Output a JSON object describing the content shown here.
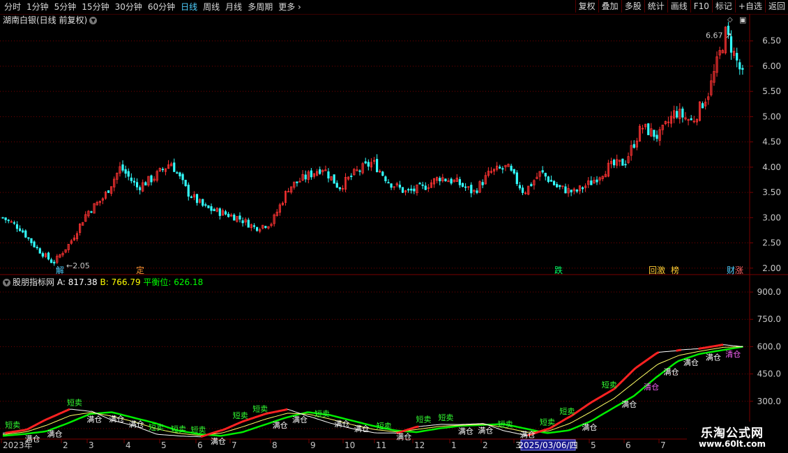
{
  "toolbar": {
    "periods": [
      {
        "label": "分时",
        "active": false
      },
      {
        "label": "1分钟",
        "active": false
      },
      {
        "label": "5分钟",
        "active": false
      },
      {
        "label": "15分钟",
        "active": false
      },
      {
        "label": "30分钟",
        "active": false
      },
      {
        "label": "60分钟",
        "active": false
      },
      {
        "label": "日线",
        "active": true
      },
      {
        "label": "周线",
        "active": false
      },
      {
        "label": "月线",
        "active": false
      },
      {
        "label": "多周期",
        "active": false
      },
      {
        "label": "更多",
        "active": false
      }
    ],
    "more_arrow": "›",
    "right_buttons": [
      "复权",
      "叠加",
      "多股",
      "统计",
      "画线",
      "F10",
      "标记",
      "+自选",
      "返回"
    ]
  },
  "chart_title": "湖南白银(日线 前复权)",
  "price_axis": {
    "ticks": [
      "6.50",
      "6.00",
      "5.50",
      "5.00",
      "4.50",
      "4.00",
      "3.50",
      "3.00",
      "2.50",
      "2.00"
    ]
  },
  "price_annotations": {
    "high": "6.67",
    "low": "2.05"
  },
  "event_markers": [
    "解",
    "定",
    "跌",
    "回",
    "激",
    "榜",
    "财",
    "涨"
  ],
  "indicator": {
    "name": "股朋指标网",
    "a_label": "A: 817.38",
    "b_label": "B: 766.79",
    "balance_label": "平衡位: 626.18",
    "a_color": "#ffffff",
    "b_color": "#ffff00",
    "balance_color": "#00ff00"
  },
  "indicator_axis": {
    "ticks": [
      "900.0",
      "750.0",
      "600.0",
      "450.0",
      "300.0",
      "150.0"
    ]
  },
  "signal_labels": [
    "短卖",
    "满仓",
    "满仓",
    "短卖",
    "满仓",
    "满仓",
    "满仓",
    "短卖",
    "短卖",
    "短卖",
    "满仓",
    "短卖",
    "短卖",
    "满仓",
    "满仓",
    "短卖",
    "满仓",
    "满仓",
    "短卖",
    "满仓",
    "短卖",
    "短卖",
    "满仓",
    "满仓",
    "短卖",
    "满仓",
    "短卖",
    "短卖",
    "满仓",
    "短卖",
    "满仓",
    "清仓",
    "满仓",
    "满仓",
    "满仓",
    "清仓"
  ],
  "date_axis": {
    "labels": [
      "2023年",
      "2",
      "3",
      "4",
      "5",
      "6",
      "7",
      "8",
      "9",
      "10",
      "11",
      "12",
      "1",
      "2",
      "3",
      "4",
      "5",
      "6",
      "7"
    ],
    "cursor_date": "2025/03/06/四"
  },
  "watermark": {
    "title": "乐淘公式网",
    "url": "www.60lt.com"
  },
  "colors": {
    "up": "#ff3333",
    "down": "#33ffff",
    "grid": "#7a0000",
    "axis_text": "#c8c8c8",
    "balance": "#00ee00"
  },
  "chart_data": [
    {
      "type": "candlestick",
      "title": "湖南白银(日线 前复权)",
      "x": [
        "2023-01",
        "2023-02",
        "2023-03",
        "2023-04",
        "2023-05",
        "2023-06",
        "2023-07",
        "2023-08",
        "2023-09",
        "2023-10",
        "2023-11",
        "2023-12",
        "2025-01",
        "2025-02",
        "2025-03",
        "2025-04",
        "2025-05",
        "2025-06",
        "2025-07"
      ],
      "close_path": [
        3.0,
        2.8,
        2.4,
        2.1,
        2.5,
        3.1,
        3.4,
        4.0,
        3.6,
        3.8,
        4.1,
        3.5,
        3.2,
        3.1,
        3.0,
        2.8,
        2.9,
        3.6,
        3.8,
        4.0,
        3.6,
        3.9,
        4.1,
        3.7,
        3.5,
        3.6,
        3.8,
        3.7,
        3.5,
        3.9,
        4.0,
        3.5,
        3.9,
        3.6,
        3.5,
        3.7,
        4.0,
        4.1,
        4.8,
        4.6,
        5.1,
        4.9,
        5.5,
        6.67,
        5.8
      ],
      "ylim": [
        1.9,
        6.8
      ],
      "annotations": {
        "high": 6.67,
        "low": 2.05
      }
    },
    {
      "type": "line",
      "title": "股朋指标网",
      "series": [
        {
          "name": "A",
          "last": 817.38
        },
        {
          "name": "B",
          "last": 766.79
        },
        {
          "name": "平衡位",
          "last": 626.18
        }
      ],
      "balance_path": [
        110,
        120,
        135,
        180,
        230,
        240,
        210,
        180,
        140,
        120,
        110,
        130,
        170,
        210,
        240,
        225,
        195,
        165,
        140,
        130,
        150,
        165,
        170,
        175,
        150,
        125,
        140,
        190,
        260,
        330,
        430,
        520,
        560,
        580,
        600
      ],
      "ylim": [
        100,
        950
      ]
    }
  ]
}
